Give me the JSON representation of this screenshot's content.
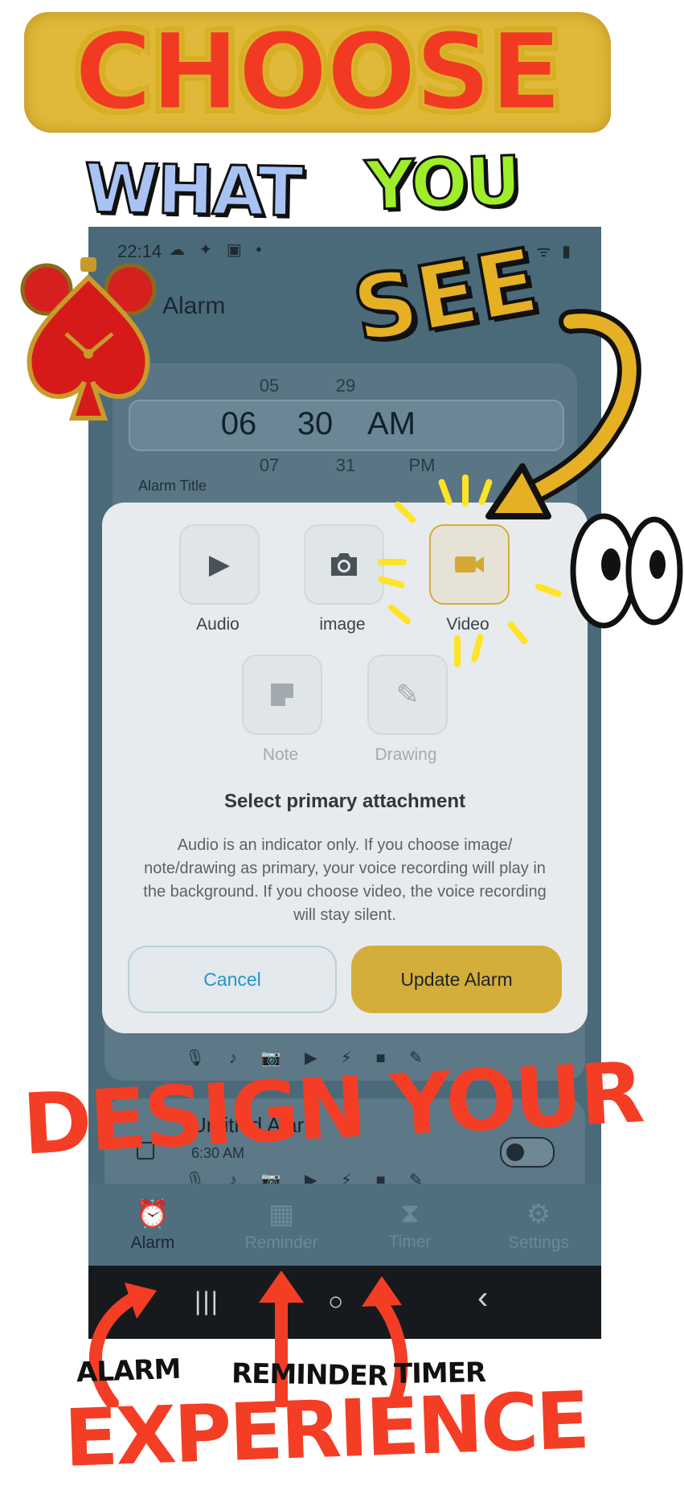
{
  "promo": {
    "headline_1": "CHOOSE",
    "headline_2a": "WHAT",
    "headline_2b": "YOU",
    "headline_3": "SEE",
    "headline_4": "DESIGN YOUR",
    "headline_5": "EXPERIENCE",
    "caption_alarm": "ALARM",
    "caption_reminder": "REMINDER",
    "caption_timer": "TIMER"
  },
  "status_bar": {
    "time": "22:14",
    "left_icons": "☁ ✦ ▣ •",
    "right_icons": "ᯤ ▮"
  },
  "app_bar": {
    "title": "Alarm"
  },
  "time_picker": {
    "prev": {
      "hour": "05",
      "minute": "29",
      "period": ""
    },
    "current": {
      "hour": "06",
      "minute": "30",
      "period": "AM"
    },
    "next": {
      "hour": "07",
      "minute": "31",
      "period": "PM"
    }
  },
  "alarm_title_label": "Alarm Title",
  "list": {
    "card2": {
      "title": "Untitled Alarm",
      "subtitle": "6:30 AM"
    },
    "attachment_icons": "🎙 ♪ 📷 ▶ ⚡ ■ ✎"
  },
  "dialog": {
    "options": [
      {
        "label": "Audio",
        "icon": "play-icon",
        "state": "normal"
      },
      {
        "label": "image",
        "icon": "camera-icon",
        "state": "normal"
      },
      {
        "label": "Video",
        "icon": "video-camera-icon",
        "state": "selected"
      },
      {
        "label": "Note",
        "icon": "note-icon",
        "state": "disabled"
      },
      {
        "label": "Drawing",
        "icon": "pencil-icon",
        "state": "disabled"
      }
    ],
    "title": "Select primary attachment",
    "description": "Audio is an indicator only. If you choose image/ note/drawing as primary, your voice recording will play in the background. If you choose video, the voice recording will stay silent.",
    "cancel_label": "Cancel",
    "confirm_label": "Update Alarm",
    "accent_color": "#d4ae3a",
    "cancel_color": "#1f97c5"
  },
  "bottom_nav": [
    {
      "label": "Alarm",
      "icon": "alarm-clock-icon",
      "active": true
    },
    {
      "label": "Reminder",
      "icon": "calendar-icon",
      "active": false
    },
    {
      "label": "Timer",
      "icon": "hourglass-icon",
      "active": false
    },
    {
      "label": "Settings",
      "icon": "gear-icon",
      "active": false
    }
  ],
  "system_nav": {
    "recents": "|||",
    "home": "○",
    "back": "‹"
  }
}
